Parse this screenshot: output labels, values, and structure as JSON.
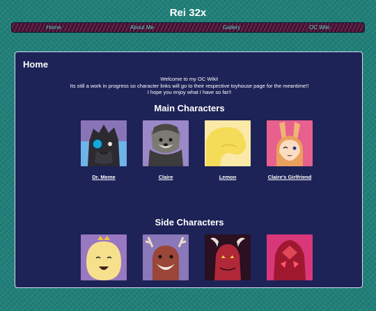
{
  "site": {
    "title": "Rei 32x"
  },
  "nav": {
    "items": [
      "Home",
      "About Me",
      "Gallery",
      "OC Wiki"
    ]
  },
  "page": {
    "title": "Home",
    "intro": [
      "Welcome to my OC Wiki!",
      "Its still a work in progress so character links will go to their respective toyhouse page for the meantime!!",
      "I hope you enjoy what I have so far!!"
    ]
  },
  "sections": {
    "main": {
      "heading": "Main Characters",
      "cards": [
        {
          "name": "Dr. Meme",
          "icon": "dark-creature-eyepatch-portrait"
        },
        {
          "name": "Claire",
          "icon": "grey-dog-portrait"
        },
        {
          "name": "Lemon",
          "icon": "yellow-blob-portrait"
        },
        {
          "name": "Claire's Girlfriend",
          "icon": "bunny-girl-portrait"
        }
      ]
    },
    "side": {
      "heading": "Side Characters",
      "cards": [
        {
          "name": "",
          "icon": "yellow-crowned-creature-portrait"
        },
        {
          "name": "",
          "icon": "antlered-deer-portrait"
        },
        {
          "name": "",
          "icon": "red-dragon-portrait"
        },
        {
          "name": "",
          "icon": "red-gem-creature-portrait"
        }
      ]
    }
  },
  "colors": {
    "background": "#1f7f78",
    "panel": "#1d2257",
    "nav_link": "#7fd8e0",
    "nav_bar": "#5a1c42"
  }
}
